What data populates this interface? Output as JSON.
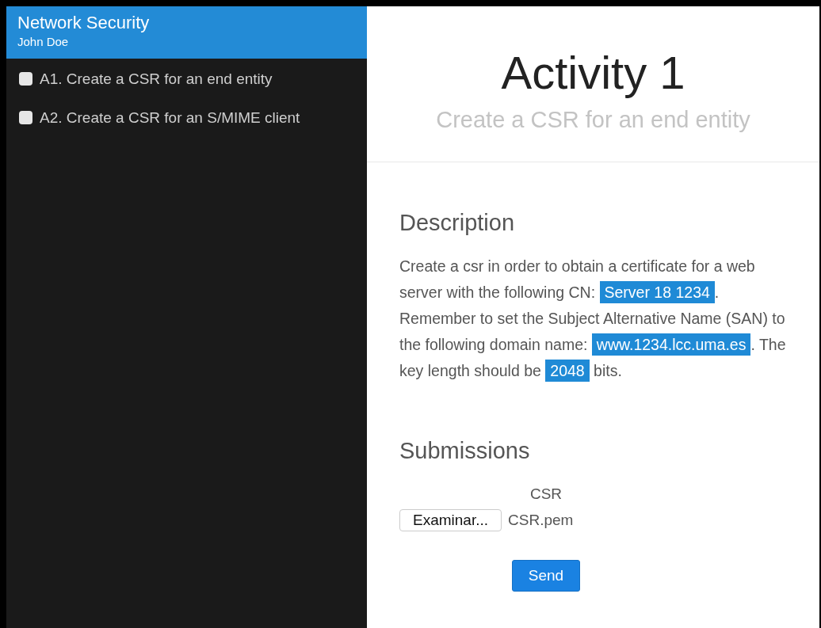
{
  "sidebar": {
    "course": "Network Security",
    "user": "John Doe",
    "items": [
      {
        "label": "A1. Create a CSR for an end entity",
        "checked": false
      },
      {
        "label": "A2. Create a CSR for an S/MIME client",
        "checked": false
      }
    ]
  },
  "header": {
    "title": "Activity 1",
    "subtitle": "Create a CSR for an end entity"
  },
  "description": {
    "heading": "Description",
    "segments": [
      {
        "text": "Create a csr in order to obtain a certificate for a web server with the following CN: ",
        "highlight": false
      },
      {
        "text": "Server 18 1234",
        "highlight": true
      },
      {
        "text": ". Remember to set the Subject Alternative Name (SAN) to the following domain name: ",
        "highlight": false
      },
      {
        "text": "www.1234.lcc.uma.es",
        "highlight": true
      },
      {
        "text": ". The key length should be ",
        "highlight": false
      },
      {
        "text": "2048",
        "highlight": true
      },
      {
        "text": " bits.",
        "highlight": false
      }
    ]
  },
  "submissions": {
    "heading": "Submissions",
    "field_label": "CSR",
    "browse_button": "Examinar...",
    "file_name": "CSR.pem",
    "send_button": "Send"
  }
}
